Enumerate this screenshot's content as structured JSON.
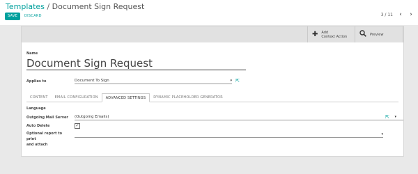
{
  "breadcrumb": {
    "parent": "Templates",
    "separator": "/",
    "current": "Document Sign Request"
  },
  "toolbar": {
    "save_label": "SAVE",
    "discard_label": "DISCARD"
  },
  "pager": {
    "value": "3 / 11",
    "prev_icon": "chevron-left-icon",
    "next_icon": "chevron-right-icon"
  },
  "smart_buttons": {
    "add_context_action": {
      "line1": "Add",
      "line2": "Context Action",
      "icon": "plus-icon"
    },
    "preview": {
      "label": "Preview",
      "icon": "search-icon"
    }
  },
  "form": {
    "name_label": "Name",
    "name_value": "Document Sign Request",
    "applies_to_label": "Applies to",
    "applies_to_value": "Document To Sign"
  },
  "tabs": [
    {
      "label": "CONTENT",
      "active": false
    },
    {
      "label": "EMAIL CONFIGURATION",
      "active": false
    },
    {
      "label": "ADVANCED SETTINGS",
      "active": true
    },
    {
      "label": "DYNAMIC PLACEHOLDER GENERATOR",
      "active": false
    }
  ],
  "advanced": {
    "language_label": "Language",
    "outgoing_mail_server_label": "Outgoing Mail Server",
    "outgoing_mail_server_value": "(Outgoing Emails)",
    "auto_delete_label": "Auto Delete",
    "auto_delete_checked": true,
    "optional_report_label_line1": "Optional report to print",
    "optional_report_label_line2": "and attach",
    "optional_report_value": ""
  },
  "colors": {
    "accent": "#00a09d",
    "header_strip": "#e1e1e1",
    "background": "#e9e9e9"
  }
}
